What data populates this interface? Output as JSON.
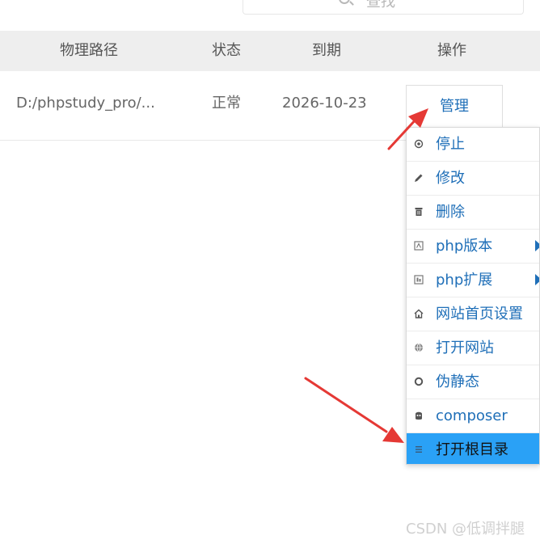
{
  "search": {
    "label": "查找"
  },
  "table": {
    "headers": {
      "path": "物理路径",
      "status": "状态",
      "expiry": "到期",
      "actions": "操作"
    },
    "row": {
      "path": "D:/phpstudy_pro/...",
      "status": "正常",
      "expiry": "2026-10-23"
    }
  },
  "manage_label": "管理",
  "menu": {
    "items": [
      {
        "label": "停止",
        "icon": "stop-icon"
      },
      {
        "label": "修改",
        "icon": "edit-icon"
      },
      {
        "label": "删除",
        "icon": "delete-icon"
      },
      {
        "label": "php版本",
        "icon": "php-version-icon",
        "submenu": true
      },
      {
        "label": "php扩展",
        "icon": "php-extension-icon",
        "submenu": true
      },
      {
        "label": "网站首页设置",
        "icon": "home-icon"
      },
      {
        "label": "打开网站",
        "icon": "globe-icon"
      },
      {
        "label": "伪静态",
        "icon": "rewrite-icon"
      },
      {
        "label": "composer",
        "icon": "composer-icon"
      },
      {
        "label": "打开根目录",
        "icon": "folder-list-icon",
        "active": true
      }
    ]
  },
  "watermark": "CSDN @低调拌腿",
  "colors": {
    "link": "#1f6fb8",
    "active_bg": "#2aa1f6",
    "annotation_arrow": "#e53935",
    "header_bg": "#eeeeee"
  }
}
